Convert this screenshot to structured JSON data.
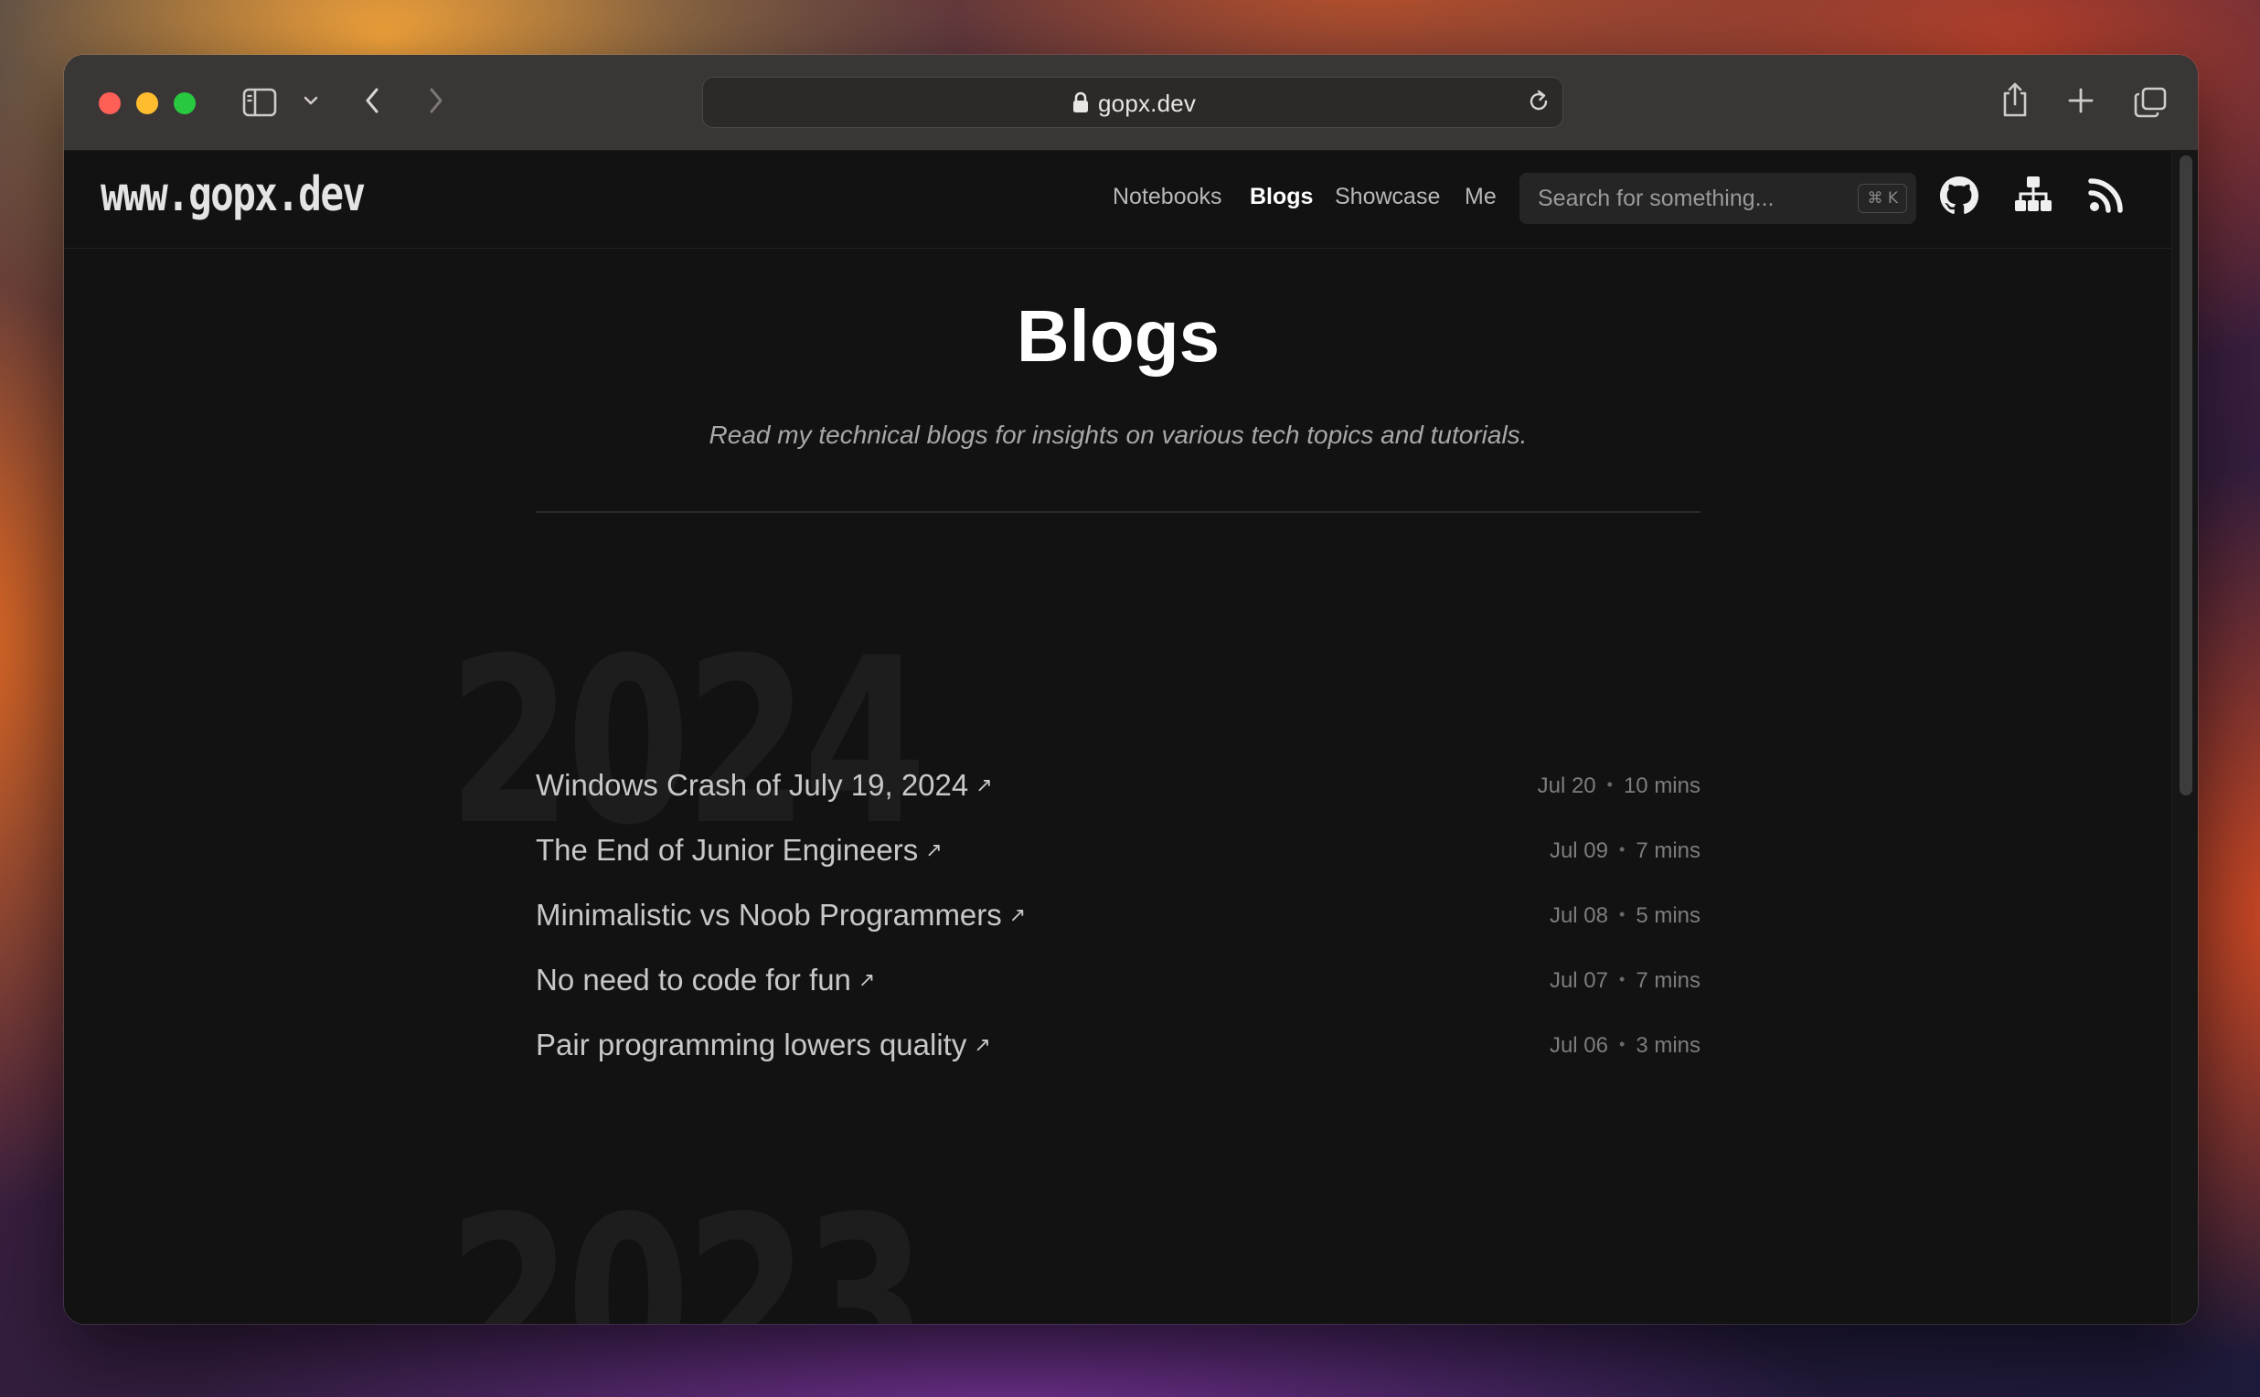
{
  "browser": {
    "url": "gopx.dev"
  },
  "site": {
    "logo": "www.gopx.dev",
    "nav": [
      {
        "label": "Notebooks",
        "active": false
      },
      {
        "label": "Blogs",
        "active": true
      },
      {
        "label": "Showcase",
        "active": false
      },
      {
        "label": "Me",
        "active": false
      }
    ],
    "search": {
      "placeholder": "Search for something...",
      "shortcut": "⌘ K"
    },
    "icons": [
      "github-icon",
      "sitemap-icon",
      "rss-icon"
    ]
  },
  "page": {
    "title": "Blogs",
    "subtitle": "Read my technical blogs for insights on various tech topics and tutorials."
  },
  "years": [
    {
      "year": "2024",
      "posts": [
        {
          "title": "Windows Crash of July 19, 2024",
          "date": "Jul 20",
          "read_time": "10 mins"
        },
        {
          "title": "The End of Junior Engineers",
          "date": "Jul 09",
          "read_time": "7 mins"
        },
        {
          "title": "Minimalistic vs Noob Programmers",
          "date": "Jul 08",
          "read_time": "5 mins"
        },
        {
          "title": "No need to code for fun",
          "date": "Jul 07",
          "read_time": "7 mins"
        },
        {
          "title": "Pair programming lowers quality",
          "date": "Jul 06",
          "read_time": "3 mins"
        }
      ]
    },
    {
      "year": "2023",
      "posts": []
    }
  ],
  "colors": {
    "page_bg": "#121212",
    "toolbar_bg": "#3a3635",
    "accent_text": "#ffffff"
  }
}
